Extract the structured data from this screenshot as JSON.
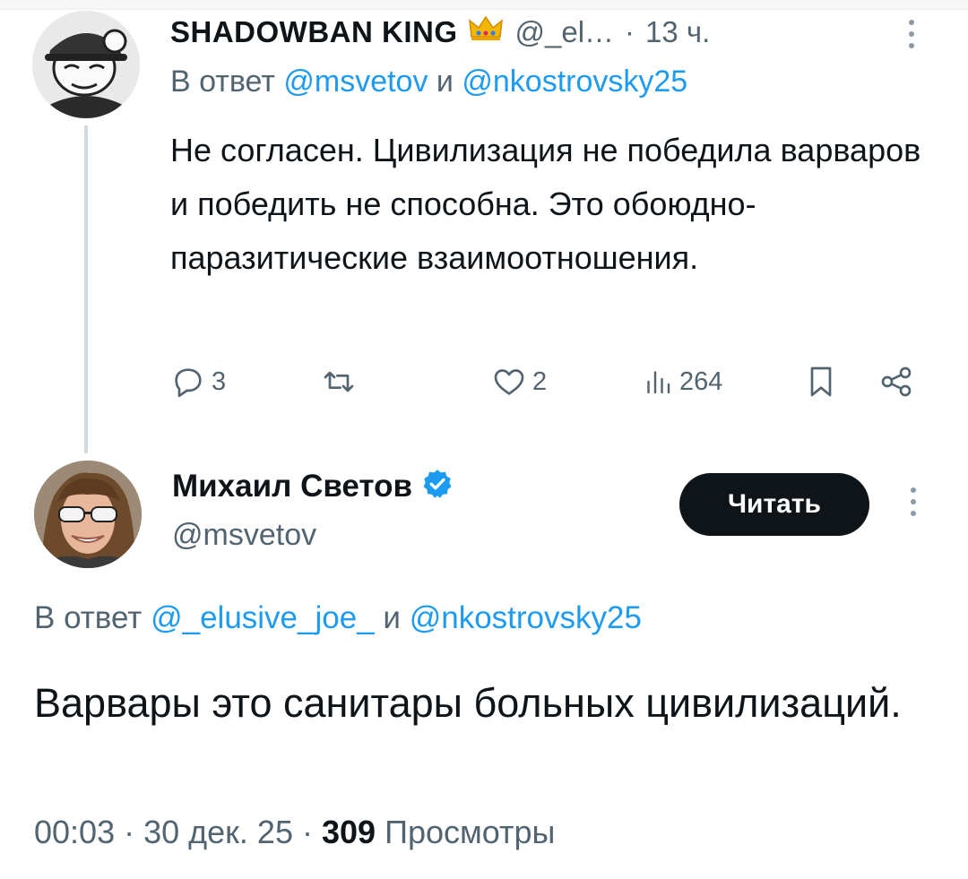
{
  "reply_tweet": {
    "author_name": "SHADOWBAN KING",
    "handle": "@_el…",
    "time": "13 ч.",
    "reply_prefix": "В ответ",
    "mention_1": "@msvetov",
    "reply_and": "и",
    "mention_2": "@nkostrovsky25",
    "text": "Не согласен. Цивилизация не победила варваров и победить не способна. Это обоюдно-паразитические взаимоотношения.",
    "replies": "3",
    "retweets": "",
    "likes": "2",
    "views": "264"
  },
  "main_tweet": {
    "author_name": "Михаил Светов",
    "handle": "@msvetov",
    "follow_label": "Читать",
    "reply_prefix": "В ответ",
    "mention_1": "@_elusive_joe_",
    "reply_and": "и",
    "mention_2": "@nkostrovsky25",
    "text": "Варвары это санитары больных цивилизаций.",
    "time": "00:03",
    "date": "30 дек. 25",
    "views_count": "309",
    "views_label": "Просмотры"
  },
  "colors": {
    "accent": "#1d9bf0",
    "secondary_text": "#536471",
    "primary_text": "#0f1419",
    "crown": "#e8b10b"
  },
  "icons": [
    "crown-icon",
    "more-icon",
    "reply-icon",
    "retweet-icon",
    "like-icon",
    "views-icon",
    "bookmark-icon",
    "share-icon",
    "verified-icon"
  ]
}
